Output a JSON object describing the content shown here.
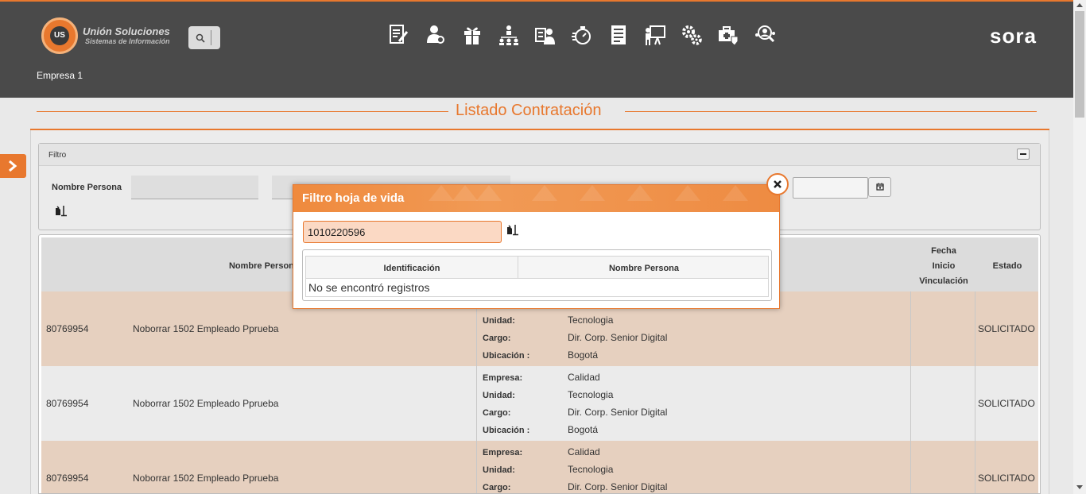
{
  "header": {
    "brand_name": "Unión Soluciones",
    "brand_sub": "Sistemas de Información",
    "logo_mark": "US",
    "product": "sora",
    "company": "Empresa 1",
    "nav_icons": [
      "resume-edit-icon",
      "person-search-icon",
      "gift-icon",
      "org-chart-icon",
      "employee-card-icon",
      "stopwatch-icon",
      "document-list-icon",
      "presentation-icon",
      "gears-icon",
      "medical-kit-icon",
      "people-search-icon"
    ]
  },
  "page": {
    "title": "Listado Contratación"
  },
  "filter": {
    "title": "Filtro",
    "nombre_persona_label": "Nombre Persona"
  },
  "grid": {
    "headers": {
      "nombre": "Nombre Persona",
      "fecha_l1": "Fecha",
      "fecha_l2": "Inicio",
      "fecha_l3": "Vinculación",
      "estado": "Estado"
    },
    "rows": [
      {
        "id": "80769954",
        "nombre": "Noborrar 1502 Empleado Pprueba",
        "empresa": "",
        "unidad": "Tecnologia",
        "cargo": "Dir. Corp. Senior Digital",
        "ubicacion": "Bogotá",
        "estado": "SOLICITADO"
      },
      {
        "id": "80769954",
        "nombre": "Noborrar 1502 Empleado Pprueba",
        "empresa": "Calidad",
        "unidad": "Tecnologia",
        "cargo": "Dir. Corp. Senior Digital",
        "ubicacion": "Bogotá",
        "estado": "SOLICITADO"
      },
      {
        "id": "80769954",
        "nombre": "Noborrar 1502 Empleado Pprueba",
        "empresa": "Calidad",
        "unidad": "Tecnologia",
        "cargo": "Dir. Corp. Senior Digital",
        "ubicacion": "",
        "estado": "SOLICITADO"
      }
    ],
    "labels": {
      "empresa": "Empresa:",
      "unidad": "Unidad:",
      "cargo": "Cargo:",
      "ubicacion": "Ubicación :"
    }
  },
  "modal": {
    "title": "Filtro hoja de vida",
    "search_value": "1010220596",
    "col_identificacion": "Identificación",
    "col_nombre": "Nombre Persona",
    "empty_text": "No se encontró registros"
  },
  "colors": {
    "accent": "#e8782e",
    "header_bg": "#4a4a4a",
    "row_alt": "#e6d0bf"
  }
}
